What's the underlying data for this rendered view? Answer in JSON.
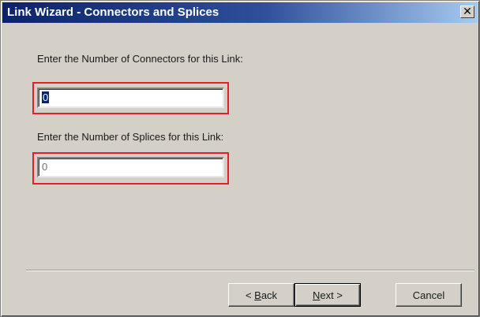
{
  "window": {
    "title": "Link Wizard - Connectors and Splices",
    "close_symbol": "✕"
  },
  "form": {
    "connectors_label": "Enter the Number of Connectors for this Link:",
    "connectors_value": "0",
    "splices_label": "Enter the Number of Splices for this Link:",
    "splices_value": "0"
  },
  "buttons": {
    "back_prefix": "< ",
    "back_accel": "B",
    "back_rest": "ack",
    "next_accel": "N",
    "next_rest": "ext >",
    "cancel": "Cancel"
  },
  "colors": {
    "highlight": "#e0202a",
    "titlebar": "#0a246a",
    "face": "#d4d0c8"
  },
  "icons": {
    "close": "close-icon"
  }
}
